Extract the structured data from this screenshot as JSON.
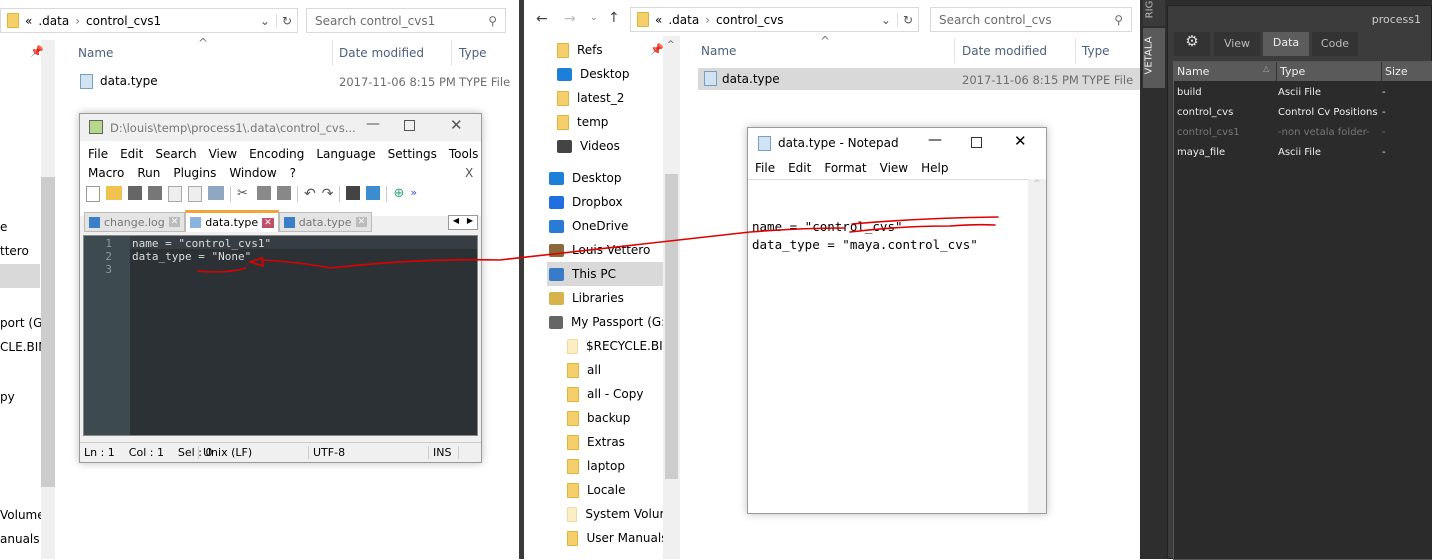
{
  "left_explorer": {
    "breadcrumb": [
      "«",
      ".data",
      "control_cvs1"
    ],
    "search_placeholder": "Search control_cvs1",
    "columns": [
      "Name",
      "Date modified",
      "Type"
    ],
    "files": [
      {
        "name": "data.type",
        "date": "2017-11-06 8:15 PM",
        "type": "TYPE File"
      }
    ],
    "nav_fragments": [
      "e",
      "ttero",
      "port (G:)",
      "CLE.BIN",
      "py",
      "Volume",
      "anuals"
    ]
  },
  "notepadpp": {
    "title": "D:\\louis\\temp\\process1\\.data\\control_cvs...",
    "menu_row1": [
      "File",
      "Edit",
      "Search",
      "View",
      "Encoding",
      "Language",
      "Settings",
      "Tools"
    ],
    "menu_row2": [
      "Macro",
      "Run",
      "Plugins",
      "Window",
      "?"
    ],
    "close_doc": "X",
    "tabs": [
      {
        "label": "change.log",
        "active": false
      },
      {
        "label": "data.type",
        "active": true
      },
      {
        "label": "data.type",
        "active": false
      }
    ],
    "lines": [
      "name = \"control_cvs1\"",
      "data_type = \"None\"",
      ""
    ],
    "status": {
      "pos": "Ln : 1    Col : 1    Sel : 0",
      "eol": "Unix (LF)",
      "encoding": "UTF-8",
      "mode": "INS"
    }
  },
  "right_explorer": {
    "breadcrumb": [
      "«",
      ".data",
      "control_cvs"
    ],
    "search_placeholder": "Search control_cvs",
    "columns": [
      "Name",
      "Date modified",
      "Type"
    ],
    "files": [
      {
        "name": "data.type",
        "date": "2017-11-06 8:15 PM",
        "type": "TYPE File"
      }
    ],
    "nav": [
      {
        "label": "Refs",
        "icon": "folder"
      },
      {
        "label": "Desktop",
        "icon": "desktop"
      },
      {
        "label": "latest_2",
        "icon": "folder"
      },
      {
        "label": "temp",
        "icon": "folder"
      },
      {
        "label": "Videos",
        "icon": "videos"
      },
      {
        "label": "Desktop",
        "icon": "desktop"
      },
      {
        "label": "Dropbox",
        "icon": "dropbox"
      },
      {
        "label": "OneDrive",
        "icon": "cloud"
      },
      {
        "label": "Louis Vettero",
        "icon": "user"
      },
      {
        "label": "This PC",
        "icon": "pc"
      },
      {
        "label": "Libraries",
        "icon": "libraries"
      },
      {
        "label": "My Passport (G:)",
        "icon": "drive"
      },
      {
        "label": "$RECYCLE.BIN",
        "icon": "folder-faint"
      },
      {
        "label": "all",
        "icon": "folder"
      },
      {
        "label": "all - Copy",
        "icon": "folder"
      },
      {
        "label": "backup",
        "icon": "folder"
      },
      {
        "label": "Extras",
        "icon": "folder"
      },
      {
        "label": "laptop",
        "icon": "folder"
      },
      {
        "label": "Locale",
        "icon": "folder"
      },
      {
        "label": "System Volume",
        "icon": "folder-faint"
      },
      {
        "label": "User Manuals",
        "icon": "folder"
      }
    ]
  },
  "notepad": {
    "title": "data.type - Notepad",
    "menu": [
      "File",
      "Edit",
      "Format",
      "View",
      "Help"
    ],
    "lines": [
      "name = \"control_cvs\"",
      "data_type = \"maya.control_cvs\""
    ]
  },
  "vetala": {
    "side_tabs": [
      "RIG",
      "VETALA"
    ],
    "process": "process1",
    "tabs": [
      "View",
      "Data",
      "Code"
    ],
    "active_tab": "Data",
    "columns": [
      "Name",
      "Type",
      "Size"
    ],
    "rows": [
      {
        "name": "build",
        "type": "Ascii File",
        "size": "-",
        "dim": false
      },
      {
        "name": "control_cvs",
        "type": "Control Cv Positions",
        "size": "-",
        "dim": false
      },
      {
        "name": "control_cvs1",
        "type": "-non vetala folder-",
        "size": "-",
        "dim": true
      },
      {
        "name": "maya_file",
        "type": "Ascii File",
        "size": "-",
        "dim": false
      }
    ]
  },
  "colors": {
    "annotation": "#e00000",
    "vetala_bg": "#3c3c3c",
    "npp_editor_bg": "#2b3135",
    "selection": "#d9d9d9"
  }
}
